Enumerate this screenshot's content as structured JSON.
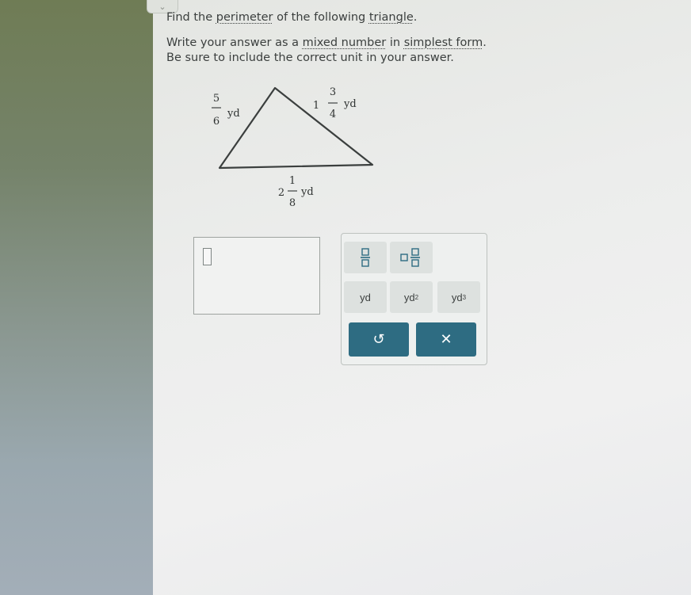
{
  "question": {
    "line1": {
      "part1": "Find the ",
      "link1": "perimeter",
      "part2": " of the following ",
      "link2": "triangle",
      "part3": "."
    },
    "line2": {
      "part1": "Write your answer as a ",
      "link1": "mixed number",
      "part2": " in ",
      "link2": "simplest form",
      "part3": "."
    },
    "line3": "Be sure to include the correct unit in your answer."
  },
  "triangle": {
    "left_side": {
      "numerator": "5",
      "denominator": "6",
      "unit": "yd"
    },
    "right_side": {
      "whole": "1",
      "numerator": "3",
      "denominator": "4",
      "unit": "yd"
    },
    "bottom_side": {
      "whole": "2",
      "numerator": "1",
      "denominator": "8",
      "unit": "yd"
    }
  },
  "answer": {
    "value": ""
  },
  "keypad": {
    "fraction_icon": "fraction-icon",
    "mixed_number_icon": "mixed-number-icon",
    "unit_yd": "yd",
    "unit_yd2_base": "yd",
    "unit_yd2_exp": "2",
    "unit_yd3_base": "yd",
    "unit_yd3_exp": "3",
    "undo_icon": "undo-icon",
    "clear_icon": "close-icon",
    "undo_glyph": "↺",
    "clear_glyph": "✕",
    "action_color": "#2e6c82"
  }
}
